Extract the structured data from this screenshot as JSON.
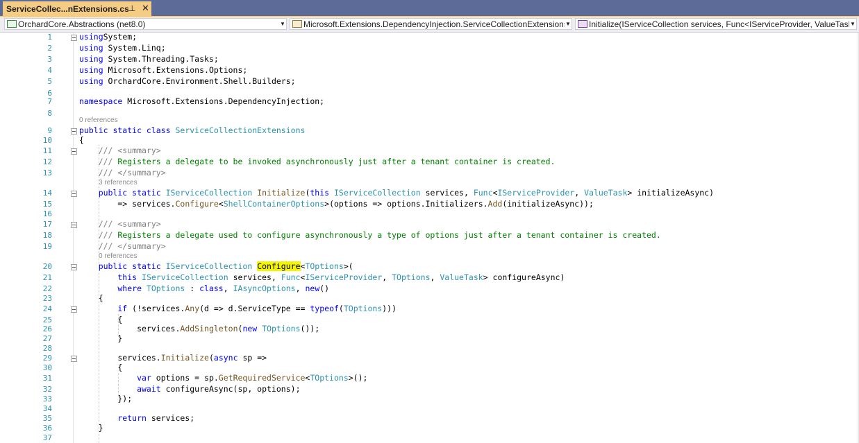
{
  "tab": {
    "title": "ServiceCollec...nExtensions.cs",
    "pin_icon": "pin-icon",
    "close_icon": "close-icon"
  },
  "nav": {
    "project": "OrchardCore.Abstractions (net8.0)",
    "type": "Microsoft.Extensions.DependencyInjection.ServiceCollectionExtensions",
    "member": "Initialize(IServiceCollection services, Func<IServiceProvider, ValueTask> initializeAsync)"
  },
  "editor": {
    "line_numbers": [
      "1",
      "2",
      "3",
      "4",
      "5",
      "6",
      "7",
      "8",
      "9",
      "10",
      "11",
      "12",
      "13",
      "14",
      "15",
      "16",
      "17",
      "18",
      "19",
      "20",
      "21",
      "22",
      "23",
      "24",
      "25",
      "26",
      "27",
      "28",
      "29",
      "30",
      "31",
      "32",
      "33",
      "34",
      "35",
      "36",
      "37"
    ],
    "codelens": [
      "0 references",
      "3 references",
      "0 references"
    ],
    "lines": [
      [
        [
          "kw",
          "using"
        ],
        [
          "",
          "System;"
        ]
      ],
      [
        [
          "kw",
          "using"
        ],
        [
          "",
          " System.Linq;"
        ]
      ],
      [
        [
          "kw",
          "using"
        ],
        [
          "",
          " System.Threading.Tasks;"
        ]
      ],
      [
        [
          "kw",
          "using"
        ],
        [
          "",
          " Microsoft.Extensions.Options;"
        ]
      ],
      [
        [
          "kw",
          "using"
        ],
        [
          "",
          " OrchardCore.Environment.Shell.Builders;"
        ]
      ],
      [],
      [
        [
          "kw",
          "namespace"
        ],
        [
          "",
          " Microsoft.Extensions.DependencyInjection;"
        ]
      ],
      [],
      [
        [
          "kw",
          "public static class"
        ],
        [
          "ty",
          " ServiceCollectionExtensions"
        ]
      ],
      [
        [
          "",
          "{"
        ]
      ],
      [
        [
          "dc",
          "    /// <summary>"
        ]
      ],
      [
        [
          "dc",
          "    ///"
        ],
        [
          "cm",
          " Registers a delegate to be invoked asynchronously just after a tenant container is created."
        ]
      ],
      [
        [
          "dc",
          "    /// </summary>"
        ]
      ],
      [
        [
          "kw",
          "    public static"
        ],
        [
          "ty",
          " IServiceCollection"
        ],
        [
          "mt",
          " Initialize"
        ],
        [
          "",
          "("
        ],
        [
          "kw",
          "this"
        ],
        [
          "ty",
          " IServiceCollection"
        ],
        [
          "",
          " services, "
        ],
        [
          "ty",
          "Func"
        ],
        [
          "",
          "<"
        ],
        [
          "ty",
          "IServiceProvider"
        ],
        [
          "",
          ", "
        ],
        [
          "ty",
          "ValueTask"
        ],
        [
          "",
          "> initializeAsync)"
        ]
      ],
      [
        [
          "",
          "        => services."
        ],
        [
          "mt",
          "Configure"
        ],
        [
          "",
          "<"
        ],
        [
          "ty",
          "ShellContainerOptions"
        ],
        [
          "",
          ">(options => options.Initializers."
        ],
        [
          "mt",
          "Add"
        ],
        [
          "",
          "(initializeAsync));"
        ]
      ],
      [],
      [
        [
          "dc",
          "    /// <summary>"
        ]
      ],
      [
        [
          "dc",
          "    ///"
        ],
        [
          "cm",
          " Registers a delegate used to configure asynchronously a type of options just after a tenant container is created."
        ]
      ],
      [
        [
          "dc",
          "    /// </summary>"
        ]
      ],
      [
        [
          "kw",
          "    public static"
        ],
        [
          "ty",
          " IServiceCollection "
        ],
        [
          "hl",
          "Configure"
        ],
        [
          "",
          "<"
        ],
        [
          "ty",
          "TOptions"
        ],
        [
          "",
          ">("
        ]
      ],
      [
        [
          "kw",
          "        this"
        ],
        [
          "ty",
          " IServiceCollection"
        ],
        [
          "",
          " services, "
        ],
        [
          "ty",
          "Func"
        ],
        [
          "",
          "<"
        ],
        [
          "ty",
          "IServiceProvider"
        ],
        [
          "",
          ", "
        ],
        [
          "ty",
          "TOptions"
        ],
        [
          "",
          ", "
        ],
        [
          "ty",
          "ValueTask"
        ],
        [
          "",
          "> configureAsync)"
        ]
      ],
      [
        [
          "kw",
          "        where"
        ],
        [
          "ty",
          " TOptions"
        ],
        [
          "",
          " : "
        ],
        [
          "kw",
          "class"
        ],
        [
          "",
          ", "
        ],
        [
          "ty",
          "IAsyncOptions"
        ],
        [
          "",
          ", "
        ],
        [
          "kw",
          "new"
        ],
        [
          "",
          "()"
        ]
      ],
      [
        [
          "",
          "    {"
        ]
      ],
      [
        [
          "kw",
          "        if"
        ],
        [
          "",
          " (!services."
        ],
        [
          "mt",
          "Any"
        ],
        [
          "",
          "(d => d.ServiceType == "
        ],
        [
          "kw",
          "typeof"
        ],
        [
          "",
          "("
        ],
        [
          "ty",
          "TOptions"
        ],
        [
          "",
          ")))"
        ]
      ],
      [
        [
          "",
          "        {"
        ]
      ],
      [
        [
          "",
          "            services."
        ],
        [
          "mt",
          "AddSingleton"
        ],
        [
          "",
          "("
        ],
        [
          "kw",
          "new"
        ],
        [
          "ty",
          " TOptions"
        ],
        [
          "",
          "());"
        ]
      ],
      [
        [
          "",
          "        }"
        ]
      ],
      [],
      [
        [
          "",
          "        services."
        ],
        [
          "mt",
          "Initialize"
        ],
        [
          "",
          "("
        ],
        [
          "kw",
          "async"
        ],
        [
          "",
          " sp =>"
        ]
      ],
      [
        [
          "",
          "        {"
        ]
      ],
      [
        [
          "kw",
          "            var"
        ],
        [
          "",
          " options = sp."
        ],
        [
          "mt",
          "GetRequiredService"
        ],
        [
          "",
          "<"
        ],
        [
          "ty",
          "TOptions"
        ],
        [
          "",
          ">();"
        ]
      ],
      [
        [
          "kw",
          "            await"
        ],
        [
          "",
          " configureAsync(sp, options);"
        ]
      ],
      [
        [
          "",
          "        });"
        ]
      ],
      [],
      [
        [
          "kw",
          "        return"
        ],
        [
          "",
          " services;"
        ]
      ],
      [
        [
          "",
          "    }"
        ]
      ],
      []
    ]
  }
}
